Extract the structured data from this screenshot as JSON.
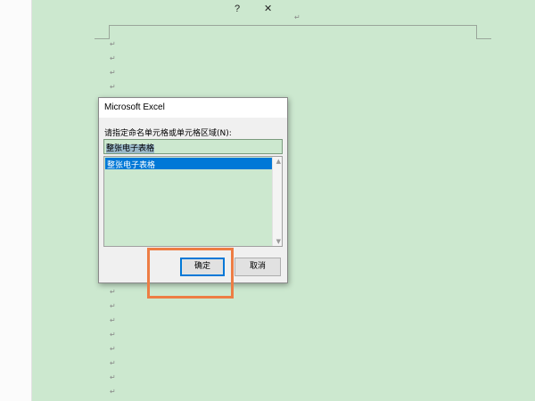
{
  "document": {
    "paragraph_mark": "↵"
  },
  "dialog": {
    "title": "Microsoft Excel",
    "help_label": "?",
    "close_label": "✕",
    "prompt": "请指定命名单元格或单元格区域(N):",
    "input_value": "整张电子表格",
    "list_items": [
      "整张电子表格"
    ],
    "selected_item": "整张电子表格",
    "ok_label": "确定",
    "cancel_label": "取消",
    "scroll_up_icon": "▲",
    "scroll_down_icon": "▼"
  },
  "colors": {
    "page_background": "#cce8cf",
    "selection": "#0078d7",
    "highlight_box": "#ed7d44"
  }
}
